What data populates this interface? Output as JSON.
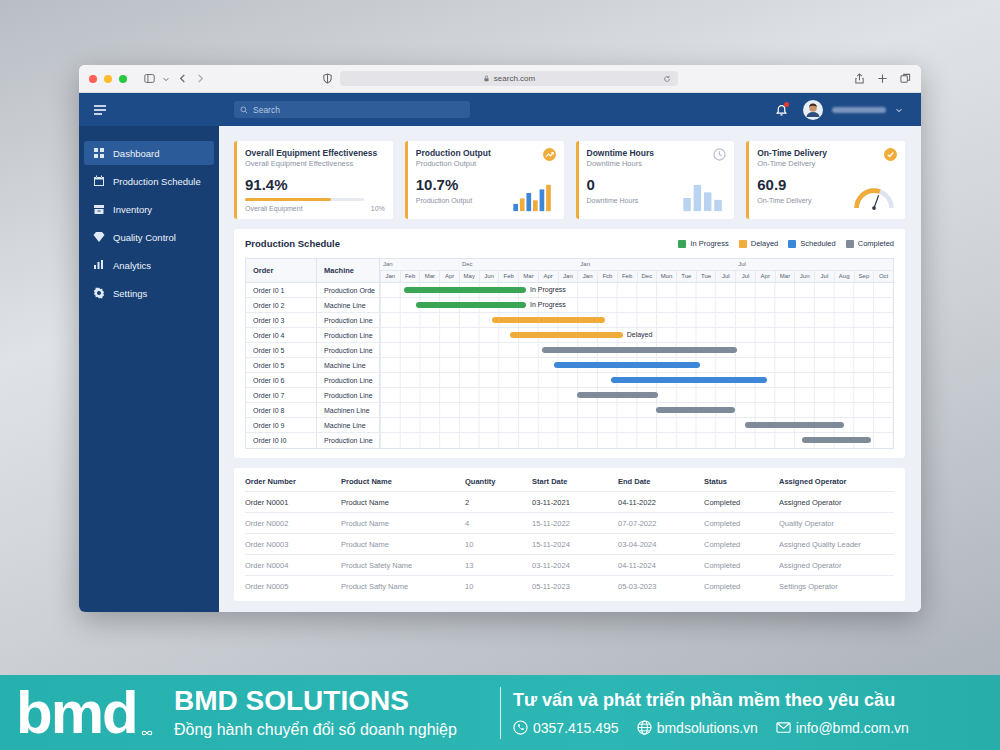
{
  "browser": {
    "address": "search.com"
  },
  "topbar": {
    "search_placeholder": "Search",
    "notification_unread": true
  },
  "sidebar": {
    "items": [
      {
        "label": "Dashboard",
        "selected": true
      },
      {
        "label": "Production Schedule",
        "selected": false
      },
      {
        "label": "Inventory",
        "selected": false
      },
      {
        "label": "Quality Control",
        "selected": false
      },
      {
        "label": "Analytics",
        "selected": false
      },
      {
        "label": "Settings",
        "selected": false
      }
    ]
  },
  "kpis": [
    {
      "kind": "progress",
      "title": "Overall Equipment Effectiveness",
      "subtitle": "Overall Equipment Effectiveness",
      "value": "91.4%",
      "footer": "Overall Equipment",
      "footer_value": "10%",
      "level": 0.72
    },
    {
      "kind": "bars",
      "title": "Production Output",
      "subtitle": "Production Output",
      "value": "10.7%",
      "footer": "Production Output",
      "spark": [
        8,
        14,
        20,
        12,
        24,
        29
      ]
    },
    {
      "kind": "columns",
      "title": "Downtime Hours",
      "subtitle": "Downtime Hours",
      "value": "0",
      "footer": "Downtime Hours",
      "spark": [
        14,
        28,
        20,
        12
      ]
    },
    {
      "kind": "gauge",
      "title": "On-Time Delivery",
      "subtitle": "On-Time Delivery",
      "value": "60.9",
      "footer": "On-Time Delivery",
      "level": 0.61
    }
  ],
  "schedule": {
    "title": "Production Schedule",
    "legend": [
      {
        "label": "In Progress",
        "color": "#3aa655"
      },
      {
        "label": "Delayed",
        "color": "#f0ac3a"
      },
      {
        "label": "Scheduled",
        "color": "#3d87d9"
      },
      {
        "label": "Completed",
        "color": "#7f8b99"
      }
    ],
    "columns": [
      "Order",
      "Machine"
    ],
    "years": [
      {
        "label": "Jan",
        "col": 0
      },
      {
        "label": "Dec",
        "col": 4
      },
      {
        "label": "Jan",
        "col": 10
      },
      {
        "label": "Jul",
        "col": 18
      }
    ],
    "months": [
      "Jan",
      "Feb",
      "Mar",
      "Apr",
      "May",
      "Jun",
      "Feb",
      "Mar",
      "Apr",
      "Jan",
      "Jan",
      "Fcb",
      "Feb",
      "Dec",
      "Mon",
      "Tue",
      "Tue",
      "Jul",
      "Jul",
      "Apr",
      "Mar",
      "Jun",
      "Jul",
      "Aug",
      "Sep",
      "Oct"
    ],
    "rows": [
      {
        "order": "Order I0 1",
        "machine": "Production Orde",
        "start": 1.2,
        "end": 7.4,
        "color": "#3aa655",
        "note": "In Progress"
      },
      {
        "order": "Order I0 2",
        "machine": "Machine Line",
        "start": 1.8,
        "end": 7.4,
        "color": "#3aa655",
        "note": "In Progress"
      },
      {
        "order": "Order I0 3",
        "machine": "Production Line",
        "start": 5.7,
        "end": 11.4,
        "color": "#f0ac3a"
      },
      {
        "order": "Order I0 4",
        "machine": "Production Line",
        "start": 6.6,
        "end": 12.3,
        "color": "#f0ac3a",
        "note": "Delayed"
      },
      {
        "order": "Order I0 5",
        "machine": "Production Line",
        "start": 8.2,
        "end": 18.1,
        "color": "#7f8b99"
      },
      {
        "order": "Order I0 5",
        "machine": "Machine Line",
        "start": 8.8,
        "end": 16.2,
        "color": "#3d87d9"
      },
      {
        "order": "Order I0 6",
        "machine": "Production Line",
        "start": 11.7,
        "end": 19.6,
        "color": "#3d87d9"
      },
      {
        "order": "Order I0 7",
        "machine": "Production Line",
        "start": 10.0,
        "end": 14.1,
        "color": "#7f8b99"
      },
      {
        "order": "Order I0 8",
        "machine": "Machinen Line",
        "start": 14.0,
        "end": 18.0,
        "color": "#7f8b99"
      },
      {
        "order": "Order I0 9",
        "machine": "Machine Line",
        "start": 18.5,
        "end": 23.5,
        "color": "#7f8b99"
      },
      {
        "order": "Order I0 I0",
        "machine": "Production Line",
        "start": 21.4,
        "end": 24.9,
        "color": "#7f8b99"
      }
    ]
  },
  "table": {
    "columns": [
      "Order Number",
      "Product Name",
      "Quantity",
      "Start Date",
      "End Date",
      "Status",
      "Assigned Operator"
    ],
    "rows": [
      {
        "muted": false,
        "cells": [
          "Order N0001",
          "Product Name",
          "2",
          "03-11-2021",
          "04-11-2022",
          "Completed",
          "Assigned Operator"
        ]
      },
      {
        "muted": true,
        "cells": [
          "Order N0002",
          "Product Name",
          "4",
          "15-11-2022",
          "07-07-2022",
          "Completed",
          "Quality Operator"
        ]
      },
      {
        "muted": true,
        "cells": [
          "Order N0003",
          "Product Name",
          "10",
          "15-11-2024",
          "03-04-2024",
          "Completed",
          "Assigned Quality Leader"
        ]
      },
      {
        "muted": true,
        "cells": [
          "Order N0004",
          "Product Safety Name",
          "13",
          "03-11-2024",
          "04-11-2024",
          "Completed",
          "Assigned Operator"
        ]
      },
      {
        "muted": true,
        "cells": [
          "Order N0005",
          "Product Safty Name",
          "10",
          "05-11-2023",
          "05-03-2023",
          "Completed",
          "Settings Operator"
        ]
      }
    ]
  },
  "banner": {
    "logo": "bmd",
    "company": "BMD SOLUTIONS",
    "tagline": "Đồng hành chuyển đổi số doanh nghiệp",
    "slogan": "Tư vấn và phát triển phần mềm theo yêu cầu",
    "phone": "0357.415.495",
    "website": "bmdsolutions.vn",
    "email": "info@bmd.com.vn"
  }
}
